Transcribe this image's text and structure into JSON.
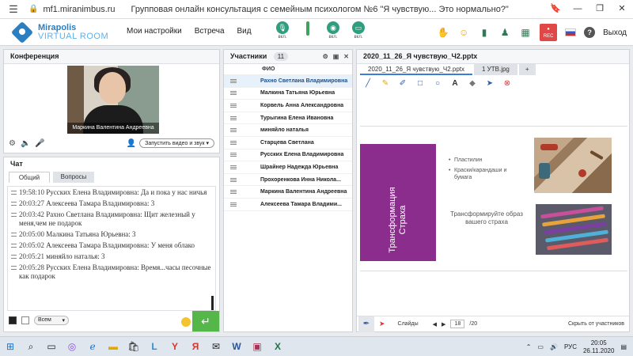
{
  "browser": {
    "url": "mf1.miranimbus.ru",
    "title": "Групповая онлайн консультация с семейным психологом №6 \"Я чувствую... Это нормально?\"",
    "minimize": "—",
    "maximize": "❐",
    "close": "✕"
  },
  "logo": {
    "line1": "Mirapolis",
    "line2": "VIRTUAL ROOM"
  },
  "menu": [
    "Мои настройки",
    "Встреча",
    "Вид"
  ],
  "media": [
    {
      "label": "вкл.",
      "icon": "microphone-icon"
    },
    {
      "label": "вкл.",
      "icon": "camera-icon"
    },
    {
      "label": "вкл.",
      "icon": "screen-share-icon"
    }
  ],
  "header_right": {
    "rec": "REC",
    "exit": "Выход",
    "help": "?"
  },
  "conference": {
    "title": "Конференция",
    "video_caption": "Маркина Валентина  Андреевна",
    "start_button": "Запустить видео и звук"
  },
  "chat": {
    "title": "Чат",
    "tabs": [
      "Общий",
      "Вопросы"
    ],
    "messages": [
      {
        "time": "19:58:10",
        "text": "Русских Елена Владимировна: Да и пока у нас ничья"
      },
      {
        "time": "20:03:27",
        "text": "Алексеева   Тамара  Владимировна: 3"
      },
      {
        "time": "20:03:42",
        "text": "Рахно Светлана  Владимировна: Щит железный у меня,чем не подарок"
      },
      {
        "time": "20:05:00",
        "text": "Малкина Татьяна  Юрьевна: 3"
      },
      {
        "time": "20:05:02",
        "text": "Алексеева   Тамара  Владимировна: У меня облако"
      },
      {
        "time": "20:05:21",
        "text": "миняйло  наталья: 3"
      },
      {
        "time": "20:05:28",
        "text": "Русских Елена Владимировна: Время...часы песочные как подарок"
      }
    ],
    "recipient": "Всем",
    "send": "↵"
  },
  "participants": {
    "title": "Участники",
    "count": "11",
    "column": "ФИО",
    "items": [
      "Рахно Светлана  Владимировна",
      "Малкина Татьяна  Юрьевна",
      "Корвель Анна  Александровна",
      "Турыгина  Елена  Ивановна",
      "миняйло  наталья",
      "Старцева  Светлана",
      "Русских Елена Владимировна",
      "Шрайнер Надежда  Юрьевна",
      "Прохоренкова  Инна  Никола...",
      "Маркина Валентина  Андреевна",
      "Алексеева   Тамара  Владими..."
    ]
  },
  "presentation": {
    "title": "2020_11_26_Я чувствую_Ч2.pptx",
    "tabs": [
      "2020_11_26_Я чувствую_Ч2.pptx",
      "1 УТВ.jpg",
      "+"
    ],
    "slide": {
      "vertical_title_1": "Трансформация",
      "vertical_title_2": "Страха",
      "bullets": [
        "Пластилин",
        "Краски/карандаши и бумага"
      ],
      "subtitle": "Трансформируйте образ вашего страха"
    },
    "footer": {
      "slides_label": "Слайды",
      "page": "18",
      "total": "/20",
      "hide": "Скрыть от участников"
    }
  },
  "taskbar": {
    "lang": "РУС",
    "time": "20:05",
    "date": "26.11.2020"
  },
  "colors": {
    "accent": "#2b7fc0",
    "slide_purple": "#8b2d8d",
    "send_green": "#55b64a",
    "rec_red": "#e04848"
  }
}
